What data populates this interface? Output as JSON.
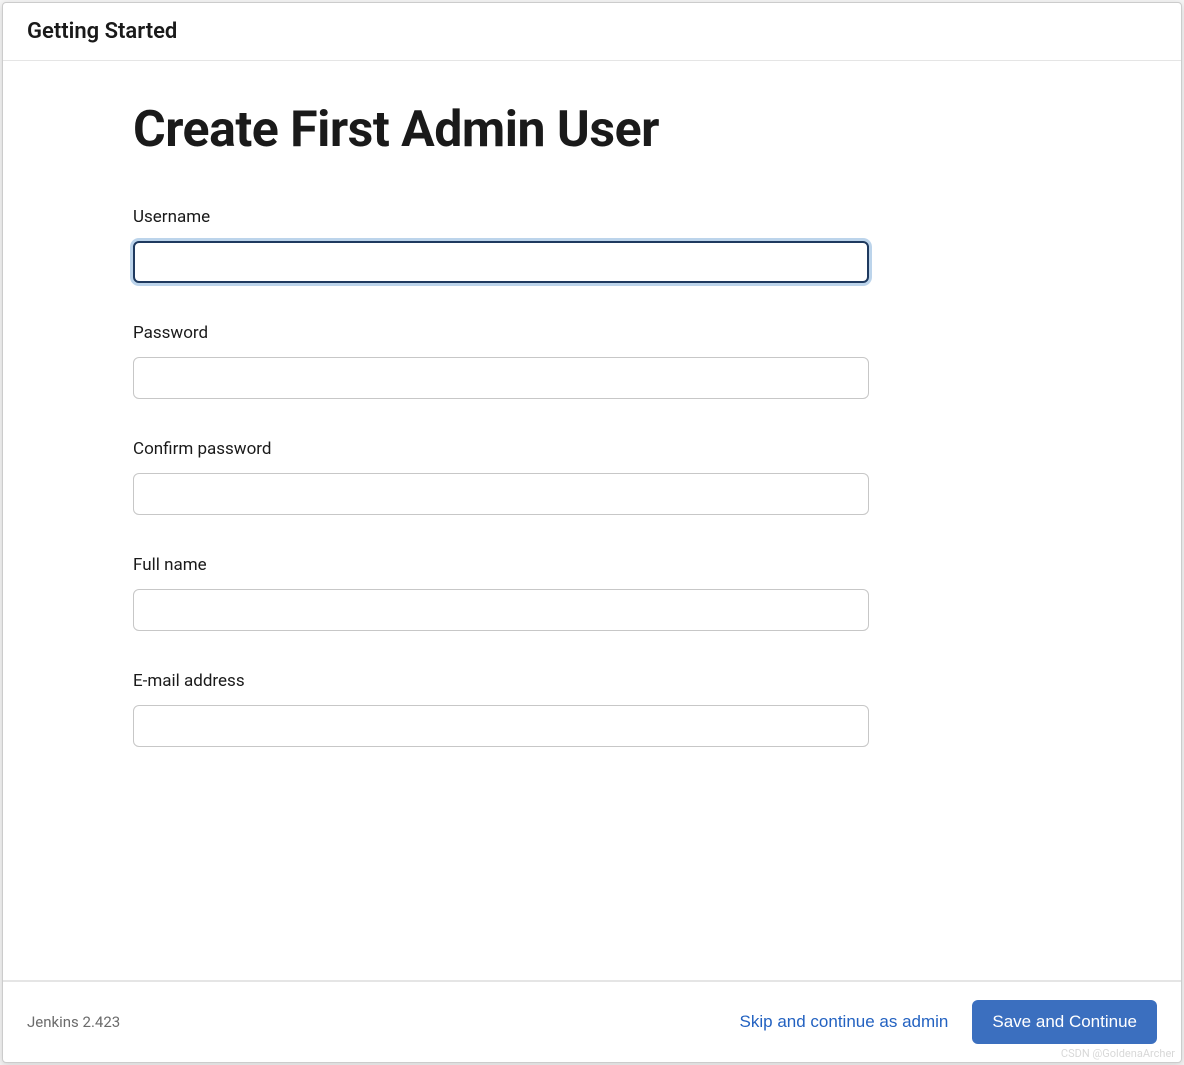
{
  "header": {
    "title": "Getting Started"
  },
  "main": {
    "title": "Create First Admin User",
    "fields": {
      "username": {
        "label": "Username",
        "value": ""
      },
      "password": {
        "label": "Password",
        "value": ""
      },
      "confirm_password": {
        "label": "Confirm password",
        "value": ""
      },
      "full_name": {
        "label": "Full name",
        "value": ""
      },
      "email": {
        "label": "E-mail address",
        "value": ""
      }
    }
  },
  "footer": {
    "version": "Jenkins 2.423",
    "skip_label": "Skip and continue as admin",
    "save_label": "Save and Continue"
  },
  "watermark": "CSDN @GoldenaArcher"
}
